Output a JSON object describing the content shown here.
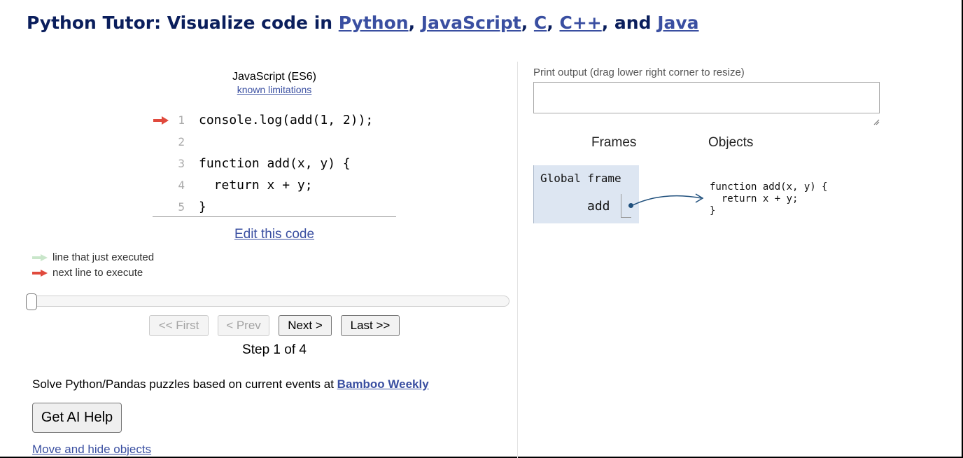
{
  "header": {
    "title_prefix": "Python Tutor: Visualize code in ",
    "languages": [
      "Python",
      "JavaScript",
      "C",
      "C++",
      "Java"
    ],
    "sep1": ", ",
    "sep2": ", ",
    "sep3": ", ",
    "sep4": ", and "
  },
  "editor": {
    "language_label": "JavaScript (ES6)",
    "limitations_link": "known limitations",
    "lines": [
      {
        "num": "1",
        "text": "console.log(add(1, 2));",
        "marker": "next"
      },
      {
        "num": "2",
        "text": "",
        "marker": ""
      },
      {
        "num": "3",
        "text": "function add(x, y) {",
        "marker": ""
      },
      {
        "num": "4",
        "text": "  return x + y;",
        "marker": ""
      },
      {
        "num": "5",
        "text": "}",
        "marker": ""
      }
    ],
    "edit_link": "Edit this code"
  },
  "legend": {
    "executed": "line that just executed",
    "next": "next line to execute",
    "executed_color": "#c9e6ca",
    "next_color": "#e04a3d"
  },
  "navigation": {
    "first": "<< First",
    "prev": "< Prev",
    "next": "Next >",
    "last": "Last >>",
    "step_text": "Step 1 of 4",
    "step_current": 1,
    "step_total": 4
  },
  "promo": {
    "text": "Solve Python/Pandas puzzles based on current events at ",
    "link": "Bamboo Weekly"
  },
  "ai_help_button": "Get AI Help",
  "move_hide_link": "Move and hide objects",
  "output": {
    "print_label": "Print output (drag lower right corner to resize)",
    "print_value": ""
  },
  "visualization": {
    "frames_header": "Frames",
    "objects_header": "Objects",
    "global_frame_title": "Global frame",
    "variable_name": "add",
    "function_object": "function add(x, y) {\n  return x + y;\n}",
    "frame_bg": "#dde6f2",
    "pointer_color": "#1f4f7c"
  },
  "colors": {
    "title": "#0a1e5c",
    "link": "#3a4fa1"
  }
}
